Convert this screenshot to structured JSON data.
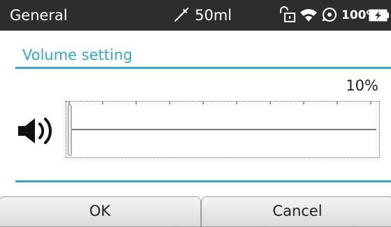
{
  "status_bar": {
    "title": "General",
    "syringe_volume": "50ml",
    "battery_percent": "100%",
    "icons": [
      "syringe-icon",
      "lock-icon",
      "wifi-icon",
      "sync-icon",
      "battery-icon"
    ]
  },
  "dialog": {
    "title": "Volume setting",
    "value_percent": "10%",
    "slider_level": 0.1,
    "speaker_icon": "speaker-icon"
  },
  "buttons": {
    "ok_label": "OK",
    "cancel_label": "Cancel"
  },
  "colors": {
    "status_bar_bg": "#2d2d2d",
    "accent": "#36a8c9"
  }
}
